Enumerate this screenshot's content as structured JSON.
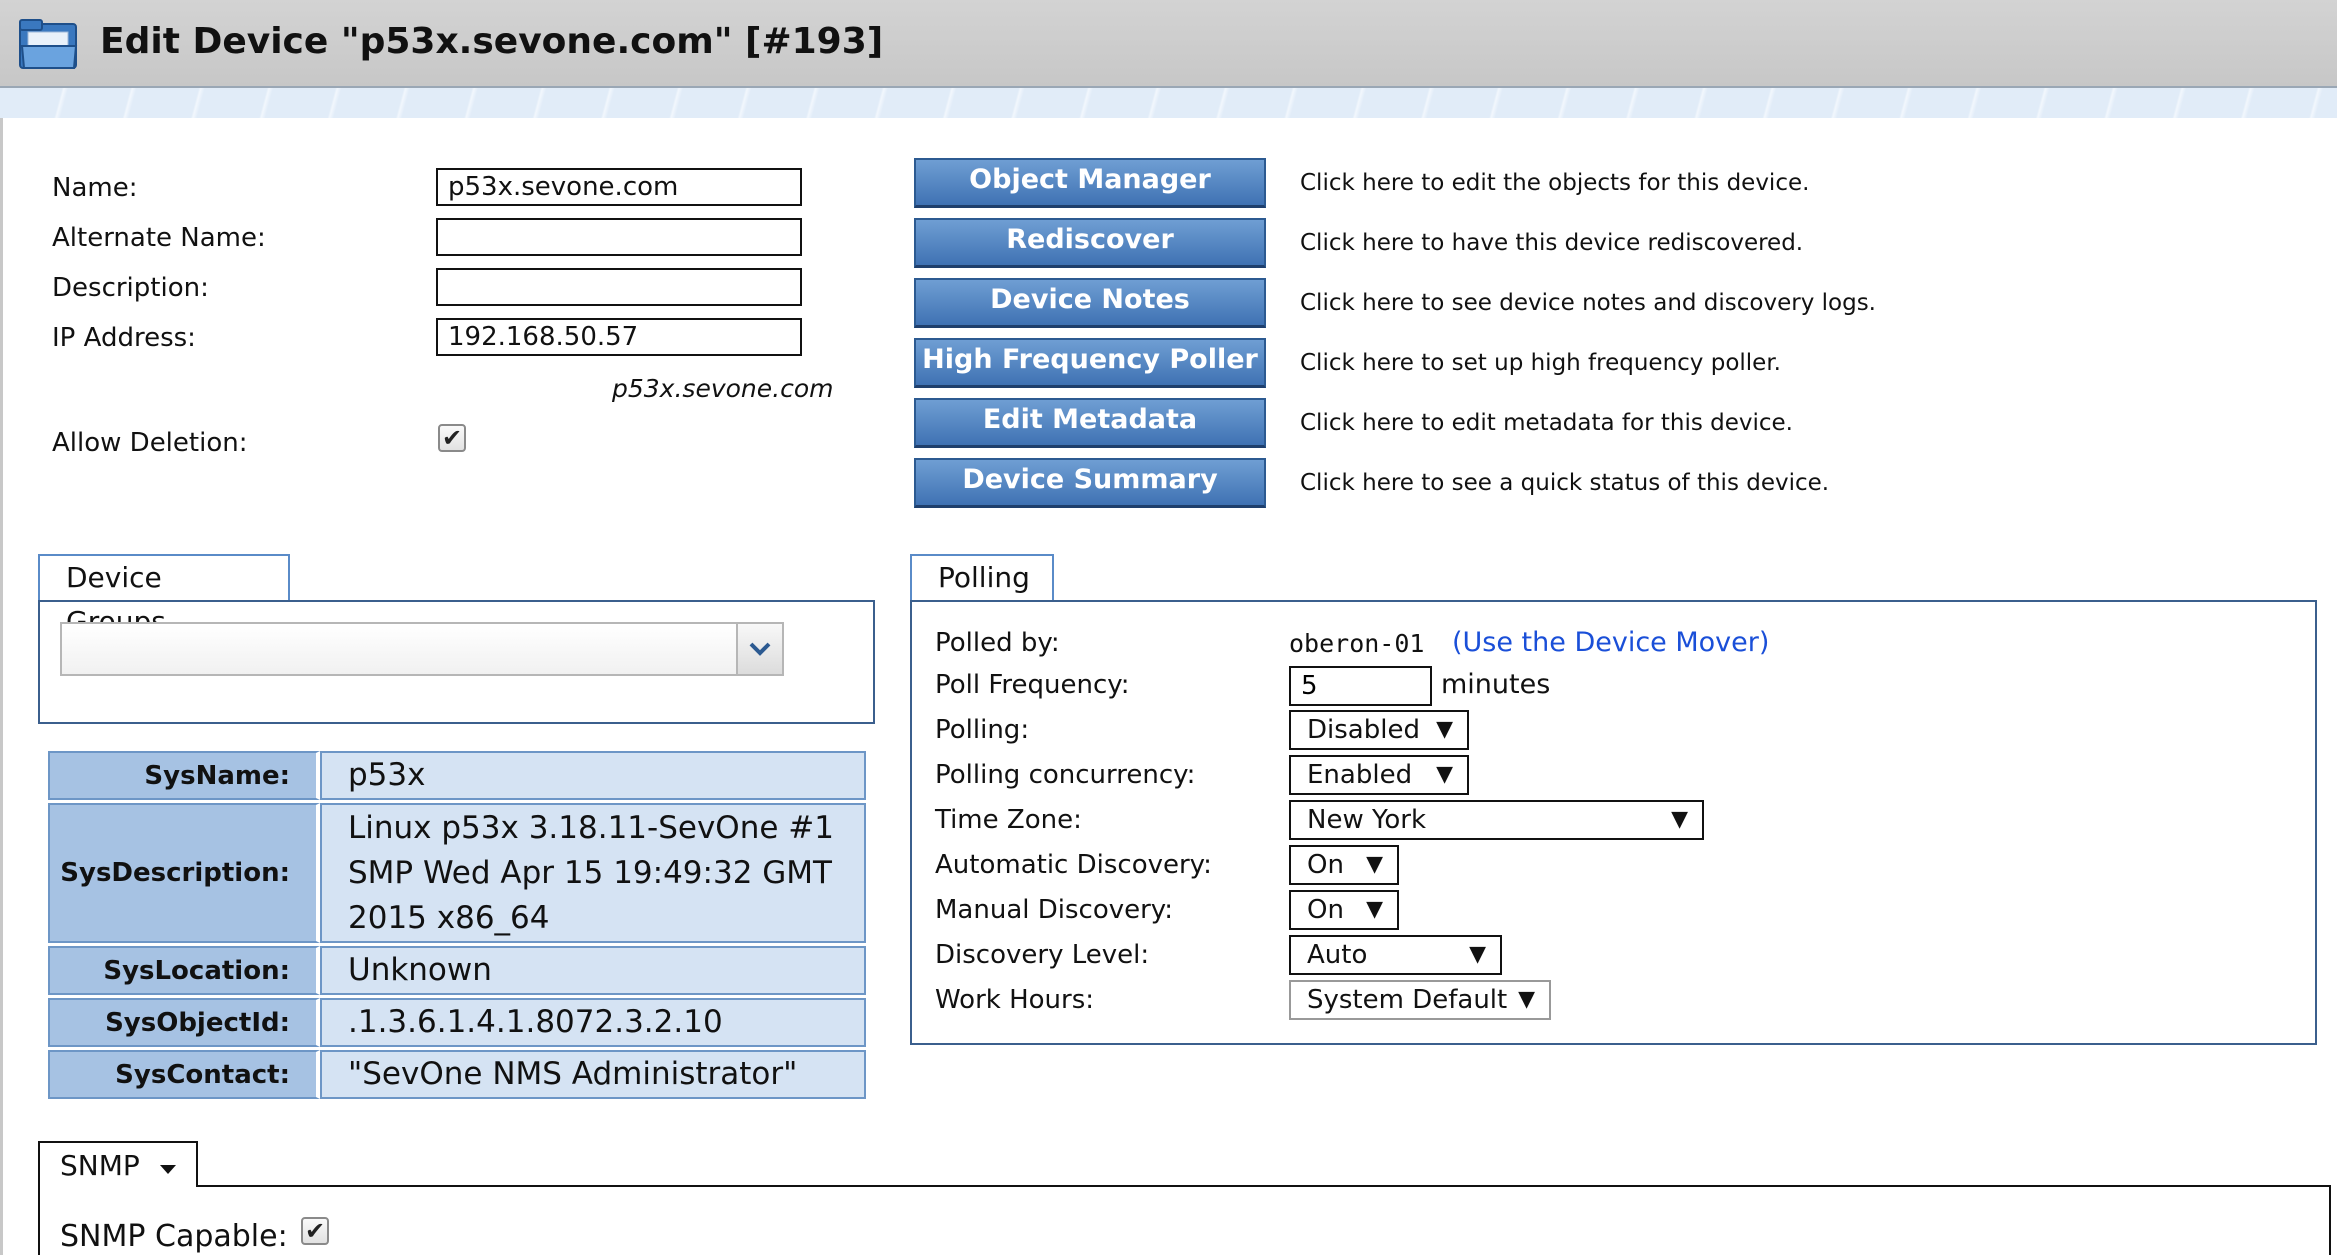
{
  "header": {
    "title": "Edit Device \"p53x.sevone.com\" [#193]",
    "icon": "folder-icon"
  },
  "form": {
    "name_label": "Name:",
    "name_value": "p53x.sevone.com",
    "alt_name_label": "Alternate Name:",
    "alt_name_value": "",
    "description_label": "Description:",
    "description_value": "",
    "ip_label": "IP Address:",
    "ip_value": "192.168.50.57",
    "dns_hint": "p53x.sevone.com",
    "allow_deletion_label": "Allow Deletion:",
    "allow_deletion_checked": true
  },
  "actions": [
    {
      "label": "Object Manager",
      "description": "Click here to edit the objects for this device."
    },
    {
      "label": "Rediscover",
      "description": "Click here to have this device rediscovered."
    },
    {
      "label": "Device Notes",
      "description": "Click here to see device notes and discovery logs."
    },
    {
      "label": "High Frequency Poller",
      "description": "Click here to set up high frequency poller."
    },
    {
      "label": "Edit Metadata",
      "description": "Click here to edit metadata for this device."
    },
    {
      "label": "Device Summary",
      "description": "Click here to see a quick status of this device."
    }
  ],
  "device_groups": {
    "tab_label": "Device Groups",
    "selected": ""
  },
  "sysinfo": [
    {
      "key": "SysName:",
      "value": "p53x"
    },
    {
      "key": "SysDescription:",
      "value": "Linux p53x 3.18.11-SevOne #1 SMP Wed Apr 15 19:49:32 GMT 2015 x86_64"
    },
    {
      "key": "SysLocation:",
      "value": "Unknown"
    },
    {
      "key": "SysObjectId:",
      "value": ".1.3.6.1.4.1.8072.3.2.10"
    },
    {
      "key": "SysContact:",
      "value": "\"SevOne NMS Administrator\""
    }
  ],
  "polling": {
    "tab_label": "Polling",
    "polled_by_label": "Polled by:",
    "polled_by_value": "oberon-01",
    "device_mover_link": "(Use the Device Mover)",
    "poll_frequency_label": "Poll Frequency:",
    "poll_frequency_value": "5",
    "poll_frequency_unit": "minutes",
    "polling_label": "Polling:",
    "polling_value": "Disabled",
    "concurrency_label": "Polling concurrency:",
    "concurrency_value": "Enabled",
    "timezone_label": "Time Zone:",
    "timezone_value": "New York",
    "auto_discovery_label": "Automatic Discovery:",
    "auto_discovery_value": "On",
    "manual_discovery_label": "Manual Discovery:",
    "manual_discovery_value": "On",
    "discovery_level_label": "Discovery Level:",
    "discovery_level_value": "Auto",
    "work_hours_label": "Work Hours:",
    "work_hours_value": "System Default",
    "dropdown_arrow": "▼"
  },
  "snmp": {
    "tab_label": "SNMP",
    "capable_label": "SNMP Capable:",
    "capable_checked": true
  },
  "colors": {
    "button_blue": "#3f72b3",
    "link_blue": "#1a4fd8",
    "table_key_bg": "#a6c2e3",
    "table_value_bg": "#d5e3f3"
  }
}
